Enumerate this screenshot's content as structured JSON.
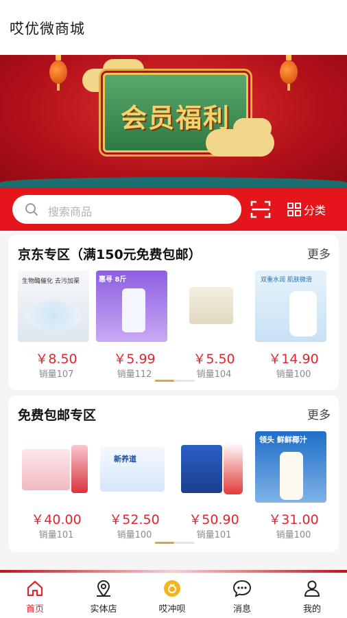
{
  "app": {
    "title": "哎优微商城"
  },
  "banner": {
    "text": "会员福利"
  },
  "search": {
    "placeholder": "搜索商品"
  },
  "header_actions": {
    "category_label": "分类"
  },
  "sections": [
    {
      "title": "京东专区（满150元免费包邮）",
      "more": "更多",
      "products": [
        {
          "price": "￥8.50",
          "sales": "销量107",
          "img_text": "生物酶催化 去污加渠"
        },
        {
          "price": "￥5.99",
          "sales": "销量112",
          "img_text": "惠寻 8斤"
        },
        {
          "price": "￥5.50",
          "sales": "销量104",
          "img_text": ""
        },
        {
          "price": "￥14.90",
          "sales": "销量100",
          "img_text": "双重水润 肌肤微滑"
        }
      ]
    },
    {
      "title": "免费包邮专区",
      "more": "更多",
      "products": [
        {
          "price": "￥40.00",
          "sales": "销量101",
          "img_text": ""
        },
        {
          "price": "￥52.50",
          "sales": "销量100",
          "img_text": "新养道"
        },
        {
          "price": "￥50.90",
          "sales": "销量101",
          "img_text": ""
        },
        {
          "price": "￥31.00",
          "sales": "销量100",
          "img_text": "领头 鲜鲜椰汁"
        }
      ]
    }
  ],
  "tabbar": [
    {
      "label": "首页",
      "icon": "home-icon",
      "active": true
    },
    {
      "label": "实体店",
      "icon": "location-icon",
      "active": false
    },
    {
      "label": "哎冲呗",
      "icon": "coin-icon",
      "active": false
    },
    {
      "label": "消息",
      "icon": "message-icon",
      "active": false
    },
    {
      "label": "我的",
      "icon": "user-icon",
      "active": false
    }
  ],
  "colors": {
    "brand_red": "#e4161c",
    "price_red": "#e0252e",
    "accent_gold": "#e6a234"
  }
}
